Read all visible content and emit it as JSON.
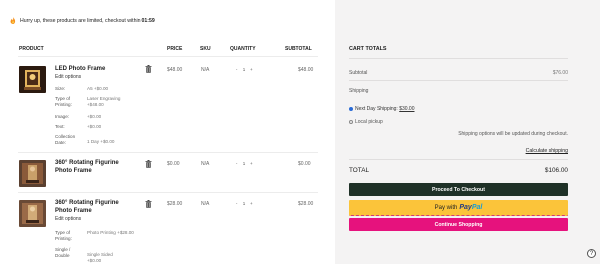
{
  "notice": {
    "text": "Hurry up, these products are limited, checkout within",
    "timer": "01:59"
  },
  "table": {
    "headers": {
      "product": "PRODUCT",
      "price": "PRICE",
      "sku": "SKU",
      "quantity": "QUANTITY",
      "subtotal": "SUBTOTAL"
    }
  },
  "items": [
    {
      "name": "LED Photo Frame",
      "edit": "Edit options",
      "price": "$48.00",
      "sku": "N/A",
      "qty": "1",
      "subtotal": "$48.00",
      "meta": [
        {
          "k": "Size:",
          "v": "A5 +$0.00"
        },
        {
          "k": "Type of Printing:",
          "v": "Laser Engraving +$48.00"
        },
        {
          "k": "Image:",
          "v": "+$0.00"
        },
        {
          "k": "Text:",
          "v": "+$0.00"
        },
        {
          "k": "Collection Date:",
          "v": "1 Day +$0.00"
        }
      ]
    },
    {
      "name": "360° Rotating Figurine Photo Frame",
      "price": "$0.00",
      "sku": "N/A",
      "qty": "1",
      "subtotal": "$0.00"
    },
    {
      "name": "360° Rotating Figurine Photo Frame",
      "edit": "Edit options",
      "price": "$28.00",
      "sku": "N/A",
      "qty": "1",
      "subtotal": "$28.00",
      "meta": [
        {
          "k": "Type of Printing:",
          "v": "Photo Printing +$28.00"
        },
        {
          "k": "Single / Double",
          "v": "Single Sided +$0.00"
        }
      ]
    }
  ],
  "cart_totals": {
    "title": "CART TOTALS",
    "subtotal_label": "Subtotal",
    "subtotal_value": "$76.00",
    "shipping_label": "Shipping",
    "shipping_option_1": "Next Day Shipping:",
    "shipping_option_1_price": "$30.00",
    "shipping_option_2": "Local pickup",
    "shipping_note": "Shipping options will be updated during checkout.",
    "calculate": "Calculate shipping",
    "total_label": "TOTAL",
    "total_value": "$106.00",
    "checkout_btn": "Proceed To Checkout",
    "paypal_prefix": "Pay with",
    "paypal_pay": "Pay",
    "paypal_pal": "Pal",
    "continue_btn": "Continue Shopping"
  },
  "help_icon": "?",
  "colors": {
    "checkout": "#1f3127",
    "paypal": "#fbc43a",
    "continue": "#e6127d",
    "selected_radio": "#2a6bd6"
  }
}
